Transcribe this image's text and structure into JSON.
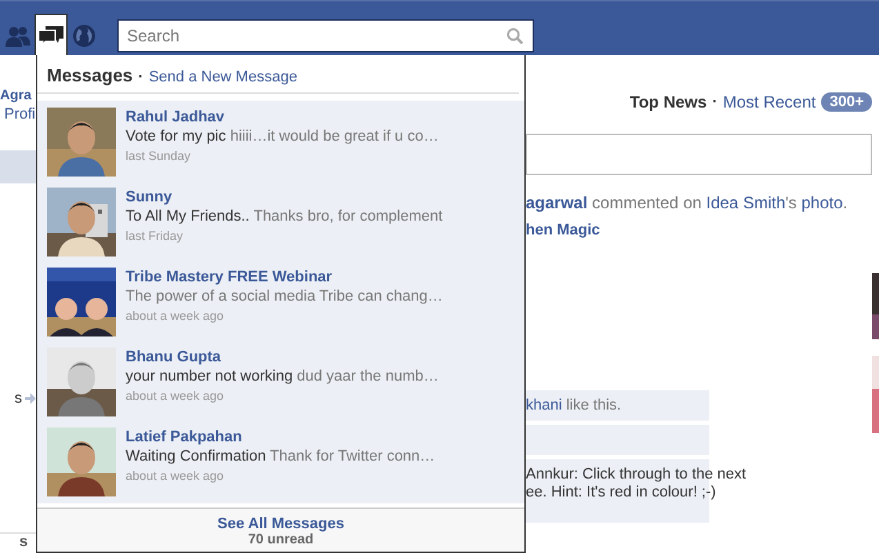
{
  "top_bar": {
    "icons": [
      {
        "kind": "friends",
        "selected": false
      },
      {
        "kind": "messages",
        "selected": true
      },
      {
        "kind": "globe",
        "selected": false
      }
    ],
    "search": {
      "placeholder": "Search"
    }
  },
  "left_column": {
    "name": "Agra",
    "link": "Profi",
    "items": [
      "s",
      "s"
    ]
  },
  "messages_menu": {
    "title": "Messages",
    "separator": "·",
    "action": "Send a New Message",
    "threads": [
      {
        "name": "Rahul Jadhav",
        "subject": "Vote for my pic",
        "preview": "hiiii…it would be great if u co…",
        "time": "last Sunday"
      },
      {
        "name": "Sunny",
        "subject": "To All My Friends..",
        "preview": "Thanks bro, for complement",
        "time": "last Friday"
      },
      {
        "name": "Tribe Mastery FREE Webinar",
        "preview": "The power of a social media Tribe can chang…",
        "time": "about a week ago"
      },
      {
        "name": "Bhanu Gupta",
        "subject": "your number not working",
        "preview": "dud yaar the numb…",
        "time": "about a week ago"
      },
      {
        "name": "Latief Pakpahan",
        "subject": "Waiting Confirmation",
        "preview": "Thank for Twitter conn…",
        "time": "about a week ago"
      }
    ],
    "footer": "See All Messages",
    "unread": "70 unread"
  },
  "feed": {
    "tabs": [
      {
        "label": "Top News",
        "selected": true
      },
      {
        "label": "Most Recent",
        "selected": false
      }
    ],
    "separator": "·",
    "badge": "300+",
    "story": [
      {
        "text": "agarwal",
        "kind": "name"
      },
      {
        "text": " commented on ",
        "kind": "plain"
      },
      {
        "text": "Idea Smith",
        "kind": "link"
      },
      {
        "text": "'s ",
        "kind": "plain"
      },
      {
        "text": "photo",
        "kind": "link"
      },
      {
        "text": ".",
        "kind": "plain"
      }
    ],
    "story_title": "hen Magic",
    "likes": [
      {
        "text": "khani",
        "kind": "link"
      },
      {
        "text": " like this.",
        "kind": "plain"
      }
    ],
    "comment_lines": [
      "Annkur: Click through to the next",
      "ee. Hint: It's red in colour! ;-)"
    ]
  }
}
